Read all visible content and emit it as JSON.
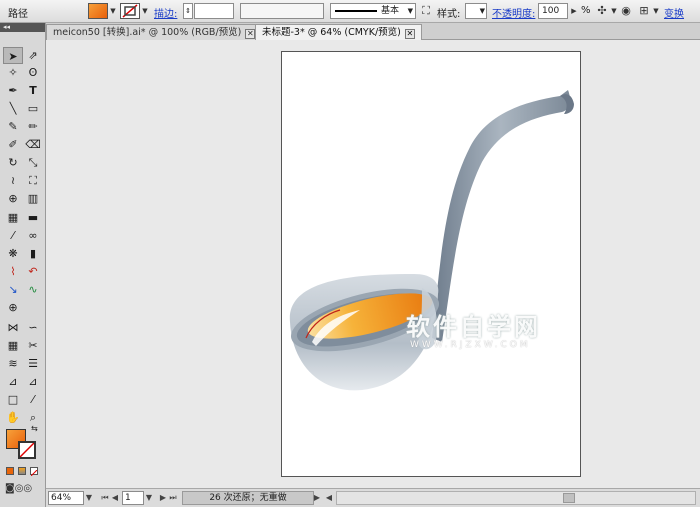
{
  "control_bar": {
    "object_type": "路径",
    "fill_color": "#f07810",
    "stroke_label": "描边:",
    "stroke_weight": "",
    "variable_width": "",
    "brush_label": "基本",
    "style_label": "样式:",
    "opacity_label": "不透明度:",
    "opacity_value": "100",
    "percent": "%",
    "transform_label": "变换"
  },
  "tabs": [
    {
      "label": "meicon50 [转换].ai* @ 100% (RGB/预览)"
    },
    {
      "label": "未标题-3* @ 64% (CMYK/预览)"
    }
  ],
  "artwork": {
    "watermark_main": "软件自学网",
    "watermark_sub": "WWW.RJZXW.COM"
  },
  "status_bar": {
    "zoom": "64%",
    "artboard_number": "1",
    "status_text": "26 次还原；无重做"
  },
  "colors": {
    "fill": "#f07810",
    "spoon_metal": "#8e9aa6",
    "soup": "#f4a21c"
  }
}
